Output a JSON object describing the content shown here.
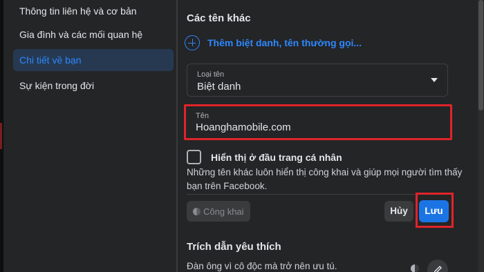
{
  "sidebar": {
    "items": [
      {
        "label": "Thông tin liên hệ và cơ bản"
      },
      {
        "label": "Gia đình và các mối quan hệ"
      },
      {
        "label": "Chi tiết về bạn"
      },
      {
        "label": "Sự kiện trong đời"
      }
    ],
    "active_index": 2
  },
  "other_names": {
    "title": "Các tên khác",
    "add_link": "Thêm biệt danh, tên thường gọi...",
    "type_field": {
      "label": "Loại tên",
      "value": "Biệt danh"
    },
    "name_field": {
      "label": "Tên",
      "value": "Hoanghamobile.com"
    },
    "show_on_profile": {
      "label": "Hiển thị ở đầu trang cá nhân",
      "checked": false
    },
    "helper_text": "Những tên khác luôn hiển thị công khai và giúp mọi người tìm thấy bạn trên Facebook.",
    "privacy_label": "Công khai",
    "cancel_label": "Hủy",
    "save_label": "Lưu"
  },
  "favorite_quotes": {
    "title": "Trích dẫn yêu thích",
    "text": "Đàn ông vì cô độc mà trở nên ưu tú."
  },
  "icons": {
    "add": "plus-circle-icon",
    "dropdown": "caret-down-icon",
    "privacy": "globe-icon",
    "edit": "pencil-icon"
  },
  "colors": {
    "accent": "#2d88ff",
    "save_button": "#1b74e4",
    "highlight_frame": "#e0242a",
    "panel": "#242526"
  }
}
